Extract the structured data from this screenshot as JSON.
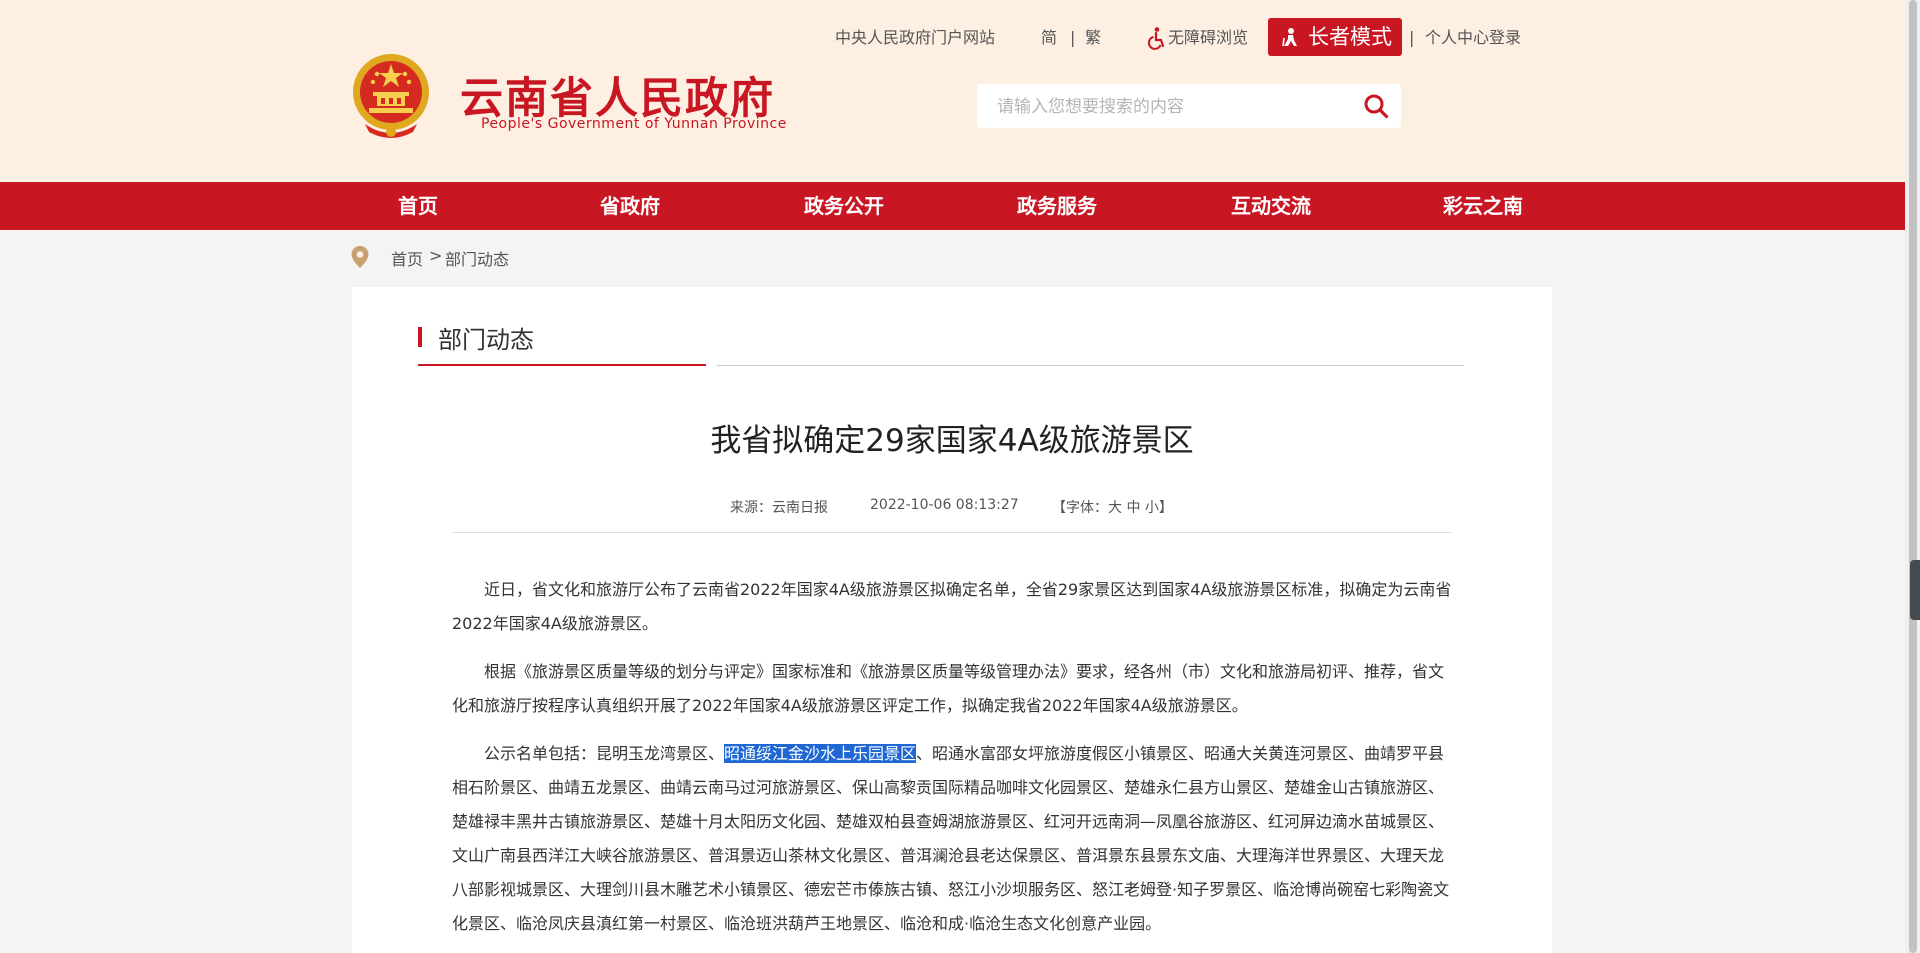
{
  "header": {
    "site_name": "云南省人民政府",
    "site_name_en": "People's Government of Yunnan Province",
    "links": {
      "central_portal": "中央人民政府门户网站",
      "simplified": "简",
      "separator1": "|",
      "traditional": "繁",
      "accessibility": "无障碍浏览",
      "elder_mode": "长者模式",
      "separator2": "|",
      "login": "个人中心登录"
    },
    "search": {
      "placeholder": "请输入您想要搜索的内容",
      "value": ""
    }
  },
  "nav": {
    "items": [
      "首页",
      "省政府",
      "政务公开",
      "政务服务",
      "互动交流",
      "彩云之南"
    ]
  },
  "breadcrumb": {
    "home": "首页",
    "separator": ">",
    "current": "部门动态"
  },
  "section": {
    "title": "部门动态"
  },
  "article": {
    "title": "我省拟确定29家国家4A级旅游景区",
    "source": "来源：云南日报",
    "datetime": "2022-10-06 08:13:27",
    "font_size": "【字体：大 中 小】",
    "paragraphs": [
      "近日，省文化和旅游厅公布了云南省2022年国家4A级旅游景区拟确定名单，全省29家景区达到国家4A级旅游景区标准，拟确定为云南省2022年国家4A级旅游景区。",
      "根据《旅游景区质量等级的划分与评定》国家标准和《旅游景区质量等级管理办法》要求，经各州（市）文化和旅游局初评、推荐，省文化和旅游厅按程序认真组织开展了2022年国家4A级旅游景区评定工作，拟确定我省2022年国家4A级旅游景区。"
    ],
    "list_paragraph": {
      "prefix": "公示名单包括：昆明玉龙湾景区、",
      "highlighted": "昭通绥江金沙水上乐园景区",
      "rest": "、昭通水富邵女坪旅游度假区小镇景区、昭通大关黄连河景区、曲靖罗平县相石阶景区、曲靖五龙景区、曲靖云南马过河旅游景区、保山高黎贡国际精品咖啡文化园景区、楚雄永仁县方山景区、楚雄金山古镇旅游区、楚雄禄丰黑井古镇旅游景区、楚雄十月太阳历文化园、楚雄双柏县查姆湖旅游景区、红河开远南洞—凤凰谷旅游区、红河屏边滴水苗城景区、文山广南县西洋江大峡谷旅游景区、普洱景迈山茶林文化景区、普洱澜沧县老达保景区、普洱景东县景东文庙、大理海洋世界景区、大理天龙八部影视城景区、大理剑川县木雕艺术小镇景区、德宏芒市傣族古镇、怒江小沙坝服务区、怒江老姆登·知子罗景区、临沧博尚碗窑七彩陶瓷文化景区、临沧凤庆县滇红第一村景区、临沧班洪葫芦王地景区、临沧和成·临沧生态文化创意产业园。"
    }
  },
  "colors": {
    "brand_red": "#c81623",
    "header_bg": "#fdf0e2",
    "page_bg": "#f4f4f4",
    "highlight": "#1f68d4"
  },
  "icons": [
    "national-emblem",
    "accessibility-icon",
    "elder-icon",
    "search-icon",
    "location-pin-icon"
  ]
}
